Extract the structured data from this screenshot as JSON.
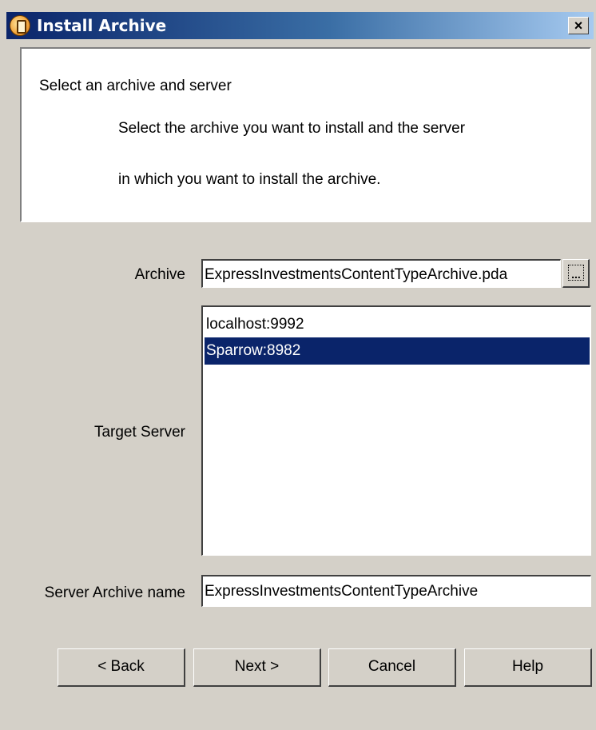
{
  "window": {
    "title": "Install Archive",
    "close_glyph": "×"
  },
  "header": {
    "title": "Select an archive and server",
    "desc_line1": "Select the archive you want to install and the server",
    "desc_line2": "in which you want to install the archive."
  },
  "form": {
    "archive_label": "Archive",
    "archive_value": "ExpressInvestmentsContentTypeArchive.pda",
    "browse_label": "...",
    "target_server_label": "Target Server",
    "servers": [
      {
        "name": "localhost:9992",
        "selected": false
      },
      {
        "name": "Sparrow:8982",
        "selected": true
      }
    ],
    "server_archive_label": "Server Archive name",
    "server_archive_value": "ExpressInvestmentsContentTypeArchive"
  },
  "buttons": {
    "back": "< Back",
    "next": "Next >",
    "cancel": "Cancel",
    "help": "Help"
  },
  "colors": {
    "selection": "#0a246a",
    "dialog_bg": "#d4d0c8"
  },
  "icons": {
    "title_icon": "archive-install-icon",
    "close_icon": "close-icon"
  }
}
